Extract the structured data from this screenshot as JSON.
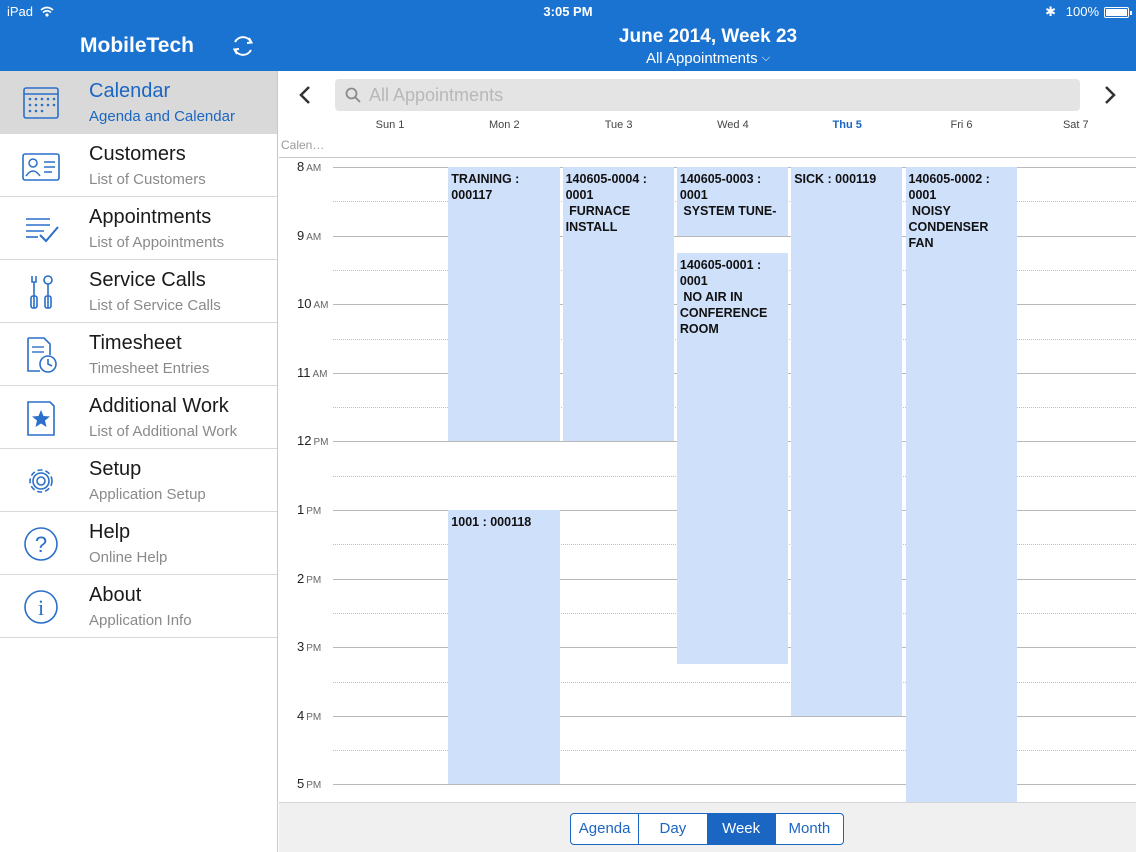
{
  "status_bar": {
    "carrier": "iPad",
    "time": "3:05 PM",
    "battery": "100%"
  },
  "app": {
    "title": "MobileTech"
  },
  "header": {
    "title": "June 2014, Week 23",
    "subtitle": "All Appointments"
  },
  "sidebar": {
    "items": [
      {
        "label": "Calendar",
        "sub": "Agenda and Calendar",
        "icon": "calendar-icon",
        "active": true
      },
      {
        "label": "Customers",
        "sub": "List of Customers",
        "icon": "customer-card-icon"
      },
      {
        "label": "Appointments",
        "sub": "List of Appointments",
        "icon": "checklist-icon"
      },
      {
        "label": "Service Calls",
        "sub": "List of Service Calls",
        "icon": "tools-icon"
      },
      {
        "label": "Timesheet",
        "sub": "Timesheet Entries",
        "icon": "timesheet-clock-icon"
      },
      {
        "label": "Additional Work",
        "sub": "List of Additional Work",
        "icon": "star-document-icon"
      },
      {
        "label": "Setup",
        "sub": "Application Setup",
        "icon": "gear-icon"
      },
      {
        "label": "Help",
        "sub": "Online Help",
        "icon": "question-icon"
      },
      {
        "label": "About",
        "sub": "Application Info",
        "icon": "info-icon"
      }
    ]
  },
  "calendar": {
    "search_placeholder": "All Appointments",
    "calendar_label": "Calen…",
    "days": [
      {
        "name": "Sun",
        "num": "1"
      },
      {
        "name": "Mon",
        "num": "2"
      },
      {
        "name": "Tue",
        "num": "3"
      },
      {
        "name": "Wed",
        "num": "4"
      },
      {
        "name": "Thu",
        "num": "5",
        "today": true
      },
      {
        "name": "Fri",
        "num": "6"
      },
      {
        "name": "Sat",
        "num": "7"
      }
    ],
    "hours": [
      {
        "h": "8",
        "ap": "AM"
      },
      {
        "h": "9",
        "ap": "AM"
      },
      {
        "h": "10",
        "ap": "AM"
      },
      {
        "h": "11",
        "ap": "AM"
      },
      {
        "h": "12",
        "ap": "PM"
      },
      {
        "h": "1",
        "ap": "PM"
      },
      {
        "h": "2",
        "ap": "PM"
      },
      {
        "h": "3",
        "ap": "PM"
      },
      {
        "h": "4",
        "ap": "PM"
      },
      {
        "h": "5",
        "ap": "PM"
      }
    ],
    "appointments": [
      {
        "day": 1,
        "start": 8.0,
        "end": 12.0,
        "text": "TRAINING :\n000117"
      },
      {
        "day": 1,
        "start": 13.0,
        "end": 17.0,
        "text": "1001 : 000118"
      },
      {
        "day": 2,
        "start": 8.0,
        "end": 12.0,
        "text": "140605-0004 :\n0001\n FURNACE\nINSTALL"
      },
      {
        "day": 3,
        "start": 8.0,
        "end": 9.0,
        "text": "140605-0003 :\n0001\n SYSTEM TUNE-"
      },
      {
        "day": 3,
        "start": 9.25,
        "end": 15.25,
        "text": "140605-0001 :\n0001\n NO AIR IN\nCONFERENCE\nROOM"
      },
      {
        "day": 4,
        "start": 8.0,
        "end": 16.0,
        "text": "SICK : 000119"
      },
      {
        "day": 5,
        "start": 8.0,
        "end": 17.5,
        "text": "140605-0002 :\n0001\n NOISY\nCONDENSER\nFAN"
      }
    ],
    "view_tabs": [
      {
        "label": "Agenda"
      },
      {
        "label": "Day"
      },
      {
        "label": "Week",
        "selected": true
      },
      {
        "label": "Month"
      }
    ]
  },
  "colors": {
    "header_blue": "#1a73d1",
    "accent_blue": "#1a66c2",
    "appointment_fill": "#cfe0fb"
  }
}
